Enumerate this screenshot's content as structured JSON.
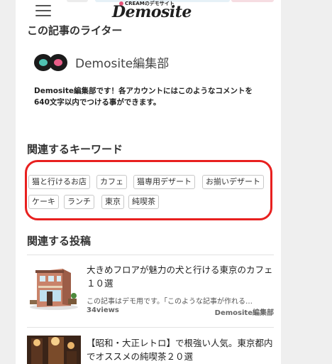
{
  "header": {
    "logo_sub": "CREAMのデモサイト",
    "logo_main": "Demosite"
  },
  "writer": {
    "heading": "この記事のライター",
    "name": "Demosite編集部",
    "desc_line1": "Demosite編集部です！各アカウントにはこのようなコメントを",
    "desc_line2": "640文字以内でつける事ができます。"
  },
  "keywords": {
    "heading": "関連するキーワード",
    "items": [
      "猫と行けるお店",
      "カフェ",
      "猫専用デザート",
      "お揃いデザート",
      "ケーキ",
      "ランチ",
      "東京",
      "純喫茶"
    ]
  },
  "related": {
    "heading": "関連する投稿",
    "posts": [
      {
        "title_line1": "大きめフロアが魅力の犬と行ける東京のカフェ",
        "title_line2": "１０選",
        "excerpt": "この記事はデモ用です。「このような記事が作れる…",
        "views": "34views",
        "author": "Demosite編集部"
      },
      {
        "title_line1": "【昭和・大正レトロ】で根強い人気。東京都内",
        "title_line2": "でオススメの純喫茶２０選"
      }
    ]
  },
  "colors": {
    "highlight_box": "#e8201f",
    "logo_left": "#4fc1b1",
    "logo_right": "#e85d88"
  }
}
